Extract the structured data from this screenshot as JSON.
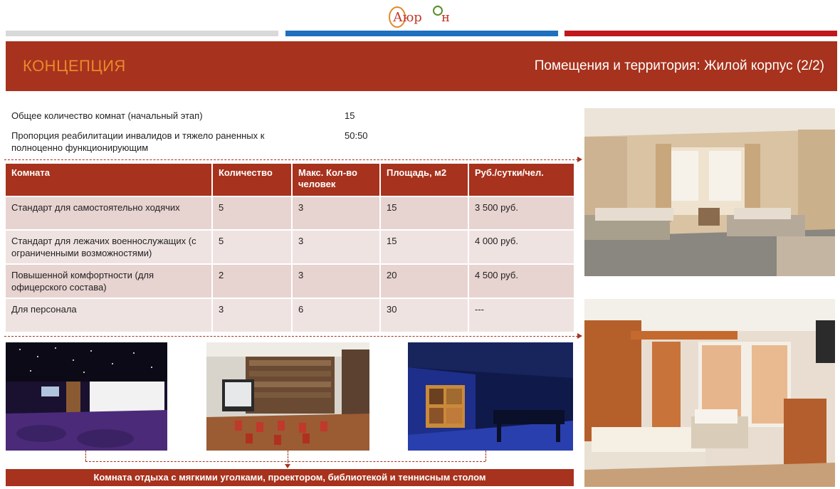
{
  "brand": {
    "logo_text": "Аюр◌н"
  },
  "header": {
    "section": "КОНЦЕПЦИЯ",
    "title": "Помещения и территория: Жилой корпус (2/2)"
  },
  "summary": [
    {
      "label": "Общее количество комнат (начальный этап)",
      "value": "15"
    },
    {
      "label": "Пропорция реабилитации инвалидов и тяжело раненных к полноценно функционирующим",
      "value": "50:50"
    }
  ],
  "table": {
    "columns": [
      "Комната",
      "Количество",
      "Макс. Кол-во человек",
      "Площадь, м2",
      "Руб./сутки/чел."
    ],
    "rows": [
      [
        "Стандарт для самостоятельно ходячих",
        "5",
        "3",
        "15",
        "3 500 руб."
      ],
      [
        "Стандарт для лежачих военнослужащих (с ограниченными возможностями)",
        "5",
        "3",
        "15",
        "4 000 руб."
      ],
      [
        "Повышенной комфортности (для офицерского состава)",
        "2",
        "3",
        "20",
        "4 500 руб."
      ],
      [
        "Для персонала",
        "3",
        "6",
        "30",
        "---"
      ]
    ]
  },
  "caption": "Комната отдыха с мягкими уголками, проектором, библиотекой и теннисным столом",
  "colors": {
    "accent": "#a7321d",
    "header_section_text": "#e88a2c",
    "row_shade_a": "#e7d3d0",
    "row_shade_b": "#efe3e1",
    "stripe_gray": "#d9d9d9",
    "stripe_blue": "#1f6fbf",
    "stripe_red": "#c0171d"
  }
}
